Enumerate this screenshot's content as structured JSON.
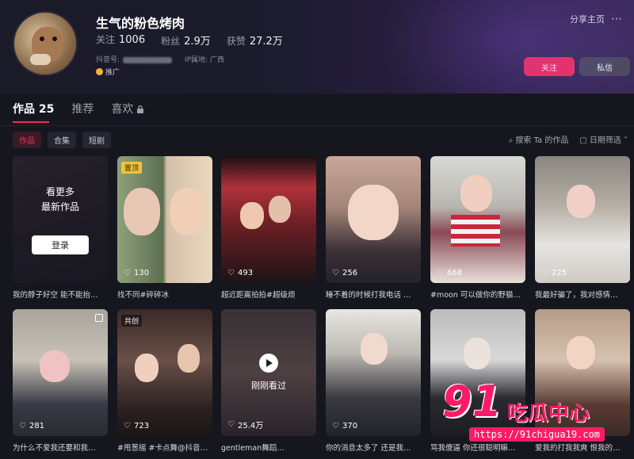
{
  "profile": {
    "nickname": "生气的粉色烤肉",
    "following_label": "关注",
    "following_value": "1006",
    "followers_label": "粉丝",
    "followers_value": "2.9万",
    "likes_label": "获赞",
    "likes_value": "27.2万",
    "id_label": "抖音号:",
    "ip_label": "IP属地: 广西",
    "promo_label": "推广",
    "share_label": "分享主页",
    "follow_button": "关注",
    "message_button": "私信"
  },
  "tabs": [
    {
      "label": "作品 25",
      "active": true
    },
    {
      "label": "推荐",
      "active": false
    },
    {
      "label": "喜欢",
      "active": false
    }
  ],
  "chips": [
    {
      "label": "作品",
      "active": true
    },
    {
      "label": "合集",
      "active": false
    },
    {
      "label": "短剧",
      "active": false
    }
  ],
  "tools": {
    "search_label": "搜索 Ta 的作品",
    "filter_label": "日期筛选"
  },
  "login_overlay": {
    "line1": "看更多",
    "line2": "最新作品",
    "button": "登录"
  },
  "watched_label": "刚刚看过",
  "videos": [
    {
      "likes": "",
      "caption": "我的脖子好空 能不能抬…",
      "badge": ""
    },
    {
      "likes": "130",
      "caption": "找不同#碎碎冰",
      "badge": "置顶"
    },
    {
      "likes": "493",
      "caption": "超近距离拍拍#超级烦",
      "badge": ""
    },
    {
      "likes": "256",
      "caption": "睡不着的时候打我电话 …",
      "badge": ""
    },
    {
      "likes": "668",
      "caption": "#moon 可以做你的野猫…",
      "badge": ""
    },
    {
      "likes": "225",
      "caption": "我最好骗了，我对感情…",
      "badge": ""
    },
    {
      "likes": "281",
      "caption": "为什么不爱我还要和我…",
      "badge": ""
    },
    {
      "likes": "723",
      "caption": "#甩葱摇 #卡点舞@抖音…",
      "badge": "共创"
    },
    {
      "likes": "25.4万",
      "caption": "gentleman舞蹈…",
      "badge": ""
    },
    {
      "likes": "370",
      "caption": "你的消息太多了 还是我…",
      "badge": ""
    },
    {
      "likes": "",
      "caption": "骂我傻逼 你还很聪明嘛…",
      "badge": ""
    },
    {
      "likes": "",
      "caption": "爱我的打我我爽 恨我的…",
      "badge": ""
    }
  ],
  "watermark": {
    "number": "91",
    "text": "吃瓜中心",
    "url": "https://91chigua19.com"
  },
  "colors": {
    "accent": "#fe2c55",
    "background": "#16161f"
  }
}
